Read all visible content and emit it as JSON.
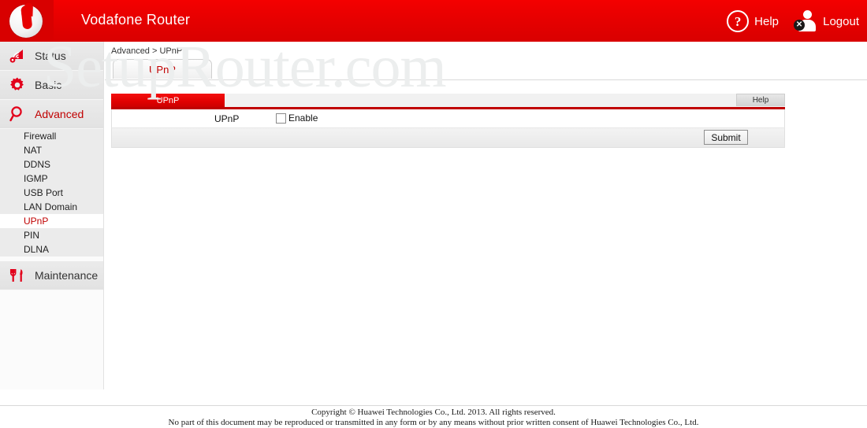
{
  "header": {
    "logo_icon": "vodafone-logo",
    "title": "Vodafone Router",
    "help_icon": "question-mark-circle-icon",
    "help_label": "Help",
    "help_glyph": "?",
    "logout_icon": "user-logout-icon",
    "logout_label": "Logout",
    "logout_badge_glyph": "✕",
    "brand_color": "#e60000"
  },
  "sidebar": {
    "items": [
      {
        "label": "Status",
        "icon": "wifi-signal-gear-icon",
        "active": false
      },
      {
        "label": "Basic",
        "icon": "gear-icon",
        "active": false
      },
      {
        "label": "Advanced",
        "icon": "magnifier-icon",
        "active": true
      }
    ],
    "sub_items": [
      {
        "label": "Firewall",
        "active": false
      },
      {
        "label": "NAT",
        "active": false
      },
      {
        "label": "DDNS",
        "active": false
      },
      {
        "label": "IGMP",
        "active": false
      },
      {
        "label": "USB Port",
        "active": false
      },
      {
        "label": "LAN Domain",
        "active": false
      },
      {
        "label": "UPnP",
        "active": true
      },
      {
        "label": "PIN",
        "active": false
      },
      {
        "label": "DLNA",
        "active": false
      }
    ],
    "maintenance": {
      "label": "Maintenance",
      "icon": "fork-knife-tools-icon"
    },
    "active_color": "#c00000"
  },
  "content": {
    "breadcrumb": "Advanced > UPnP",
    "tab": {
      "label": "UPnP"
    },
    "panel": {
      "tab_label": "UPnP",
      "help_label": "Help",
      "row_label": "UPnP",
      "checkbox_label": "Enable",
      "checkbox_checked": false,
      "submit_label": "Submit"
    }
  },
  "watermark": {
    "text": "SetupRouter.com"
  },
  "footer": {
    "line1": "Copyright © Huawei Technologies Co., Ltd. 2013. All rights reserved.",
    "line2": "No part of this document may be reproduced or transmitted in any form or by any means without prior written consent of Huawei Technologies Co., Ltd."
  }
}
